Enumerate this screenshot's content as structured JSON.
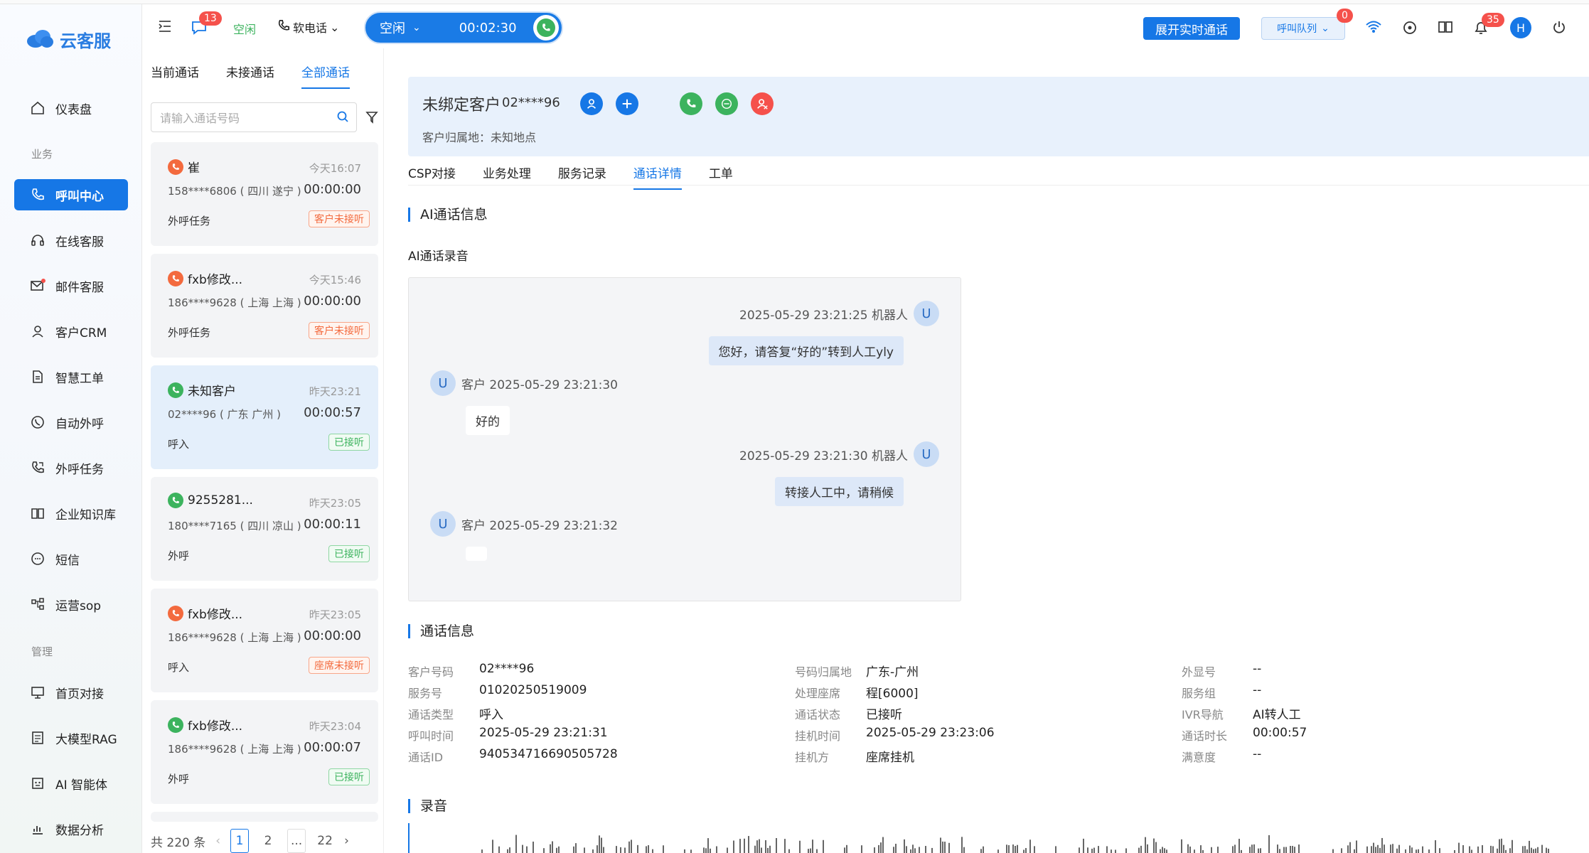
{
  "app": {
    "logo_text": "云客服"
  },
  "sidebar": {
    "groups": {
      "biz": "业务",
      "mgmt": "管理"
    },
    "items": [
      {
        "label": "仪表盘"
      },
      {
        "label": "呼叫中心"
      },
      {
        "label": "在线客服"
      },
      {
        "label": "邮件客服"
      },
      {
        "label": "客户CRM"
      },
      {
        "label": "智慧工单"
      },
      {
        "label": "自动外呼"
      },
      {
        "label": "外呼任务"
      },
      {
        "label": "企业知识库"
      },
      {
        "label": "短信"
      },
      {
        "label": "运营sop"
      },
      {
        "label": "首页对接"
      },
      {
        "label": "大模型RAG"
      },
      {
        "label": "AI 智能体"
      },
      {
        "label": "数据分析"
      }
    ]
  },
  "topbar": {
    "msg_badge": "13",
    "status": "空闲",
    "phone_mode": "软电话",
    "call_status": "空闲",
    "call_timer": "00:02:30",
    "expand_btn": "展开实时通话",
    "queue_label": "呼叫队列",
    "queue_badge": "0",
    "bell_badge": "35",
    "user_initial": "H"
  },
  "calllist": {
    "tabs": [
      "当前通话",
      "未接通话",
      "全部通话"
    ],
    "search_placeholder": "请输入通话号码",
    "items": [
      {
        "name": "崔",
        "time": "今天16:07",
        "number": "158****6806 ( 四川 遂宁 )",
        "duration": "00:00:00",
        "kind": "外呼任务",
        "tag": "客户未接听"
      },
      {
        "name": "fxb修改...",
        "time": "今天15:46",
        "number": "186****9628 ( 上海 上海 )",
        "duration": "00:00:00",
        "kind": "外呼任务",
        "tag": "客户未接听"
      },
      {
        "name": "未知客户",
        "time": "昨天23:21",
        "number": "02****96 ( 广东 广州 )",
        "duration": "00:00:57",
        "kind": "呼入",
        "tag": "已接听"
      },
      {
        "name": "9255281...",
        "time": "昨天23:05",
        "number": "180****7165 ( 四川 凉山 )",
        "duration": "00:00:11",
        "kind": "外呼",
        "tag": "已接听"
      },
      {
        "name": "fxb修改...",
        "time": "昨天23:05",
        "number": "186****9628 ( 上海 上海 )",
        "duration": "00:00:00",
        "kind": "呼入",
        "tag": "座席未接听"
      },
      {
        "name": "fxb修改...",
        "time": "昨天23:04",
        "number": "186****9628 ( 上海 上海 )",
        "duration": "00:00:07",
        "kind": "外呼",
        "tag": "已接听"
      }
    ],
    "pager": {
      "total": "共 220 条",
      "pages": [
        "1",
        "2",
        "...",
        "22"
      ]
    }
  },
  "customer": {
    "title": "未绑定客户",
    "number": "02****96",
    "location": "客户归属地：未知地点"
  },
  "detail_tabs": [
    "CSP对接",
    "业务处理",
    "服务记录",
    "通话详情",
    "工单"
  ],
  "ai": {
    "section_title": "AI通话信息",
    "sub_title": "AI通话录音",
    "messages": [
      {
        "meta": "2025-05-29 23:21:25 机器人",
        "text": "您好，请答复“好的”转到人工yly"
      },
      {
        "meta": "客户 2025-05-29 23:21:30",
        "text": "好的"
      },
      {
        "meta": "2025-05-29 23:21:30 机器人",
        "text": "转接人工中，请稍候"
      },
      {
        "meta": "客户 2025-05-29 23:21:32",
        "text": ""
      }
    ],
    "avatar": "U"
  },
  "callinfo": {
    "section_title": "通话信息",
    "col1": [
      {
        "label": "客户号码",
        "value": "02****96"
      },
      {
        "label": "服务号",
        "value": "01020250519009"
      },
      {
        "label": "通话类型",
        "value": "呼入"
      },
      {
        "label": "呼叫时间",
        "value": "2025-05-29 23:21:31"
      },
      {
        "label": "通话ID",
        "value": "940534716690505728"
      }
    ],
    "col2": [
      {
        "label": "号码归属地",
        "value": "广东-广州"
      },
      {
        "label": "处理座席",
        "value": "程[6000]"
      },
      {
        "label": "通话状态",
        "value": "已接听"
      },
      {
        "label": "挂机时间",
        "value": "2025-05-29 23:23:06"
      },
      {
        "label": "挂机方",
        "value": "座席挂机"
      }
    ],
    "col3": [
      {
        "label": "外显号",
        "value": "--"
      },
      {
        "label": "服务组",
        "value": "--"
      },
      {
        "label": "IVR导航",
        "value": "AI转人工"
      },
      {
        "label": "通话时长",
        "value": "00:00:57"
      },
      {
        "label": "满意度",
        "value": "--"
      }
    ]
  },
  "recording": {
    "section_title": "录音"
  },
  "colors": {
    "primary": "#1677e6",
    "green": "#3cb35e",
    "orange": "#f36a3e",
    "red": "#f5514b"
  }
}
